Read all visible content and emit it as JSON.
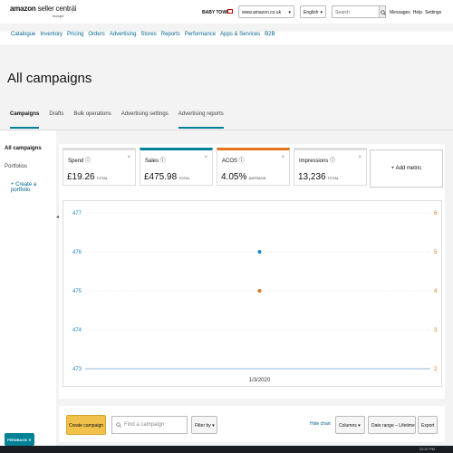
{
  "header": {
    "logo_main": "amazon",
    "logo_light": " seller central",
    "logo_region": "europe",
    "store_name": "BABY TOWN",
    "domain": "www.amazon.co.uk",
    "language": "English",
    "search_placeholder": "Search",
    "links": [
      "Messages",
      "Help",
      "Settings"
    ]
  },
  "nav": [
    "Catalogue",
    "Inventory",
    "Pricing",
    "Orders",
    "Advertising",
    "Stores",
    "Reports",
    "Performance",
    "Apps & Services",
    "B2B"
  ],
  "page_title": "All campaigns",
  "tabs": [
    "Campaigns",
    "Drafts",
    "Bulk operations",
    "Advertising settings",
    "Advertising reports"
  ],
  "sidebar": {
    "all_campaigns": "All campaigns",
    "portfolios": "Portfolios",
    "create_portfolio": "+ Create a portfolio"
  },
  "metrics": [
    {
      "label": "Spend",
      "value": "£19.26",
      "unit": "TOTAL",
      "color": "#dddddd"
    },
    {
      "label": "Sales",
      "value": "£475.98",
      "unit": "TOTAL",
      "color": "#008296"
    },
    {
      "label": "ACOS",
      "value": "4.05%",
      "unit": "AVERAGE",
      "color": "#e3741c"
    },
    {
      "label": "Impressions",
      "value": "13,236",
      "unit": "TOTAL",
      "color": "#dddddd"
    }
  ],
  "add_metric": "+ Add metric",
  "chart_data": {
    "type": "scatter",
    "x": [
      "1/3/2020"
    ],
    "left_axis": {
      "ticks": [
        "477",
        "476",
        "475",
        "474",
        "473"
      ],
      "color": "#1e88c9"
    },
    "right_axis": {
      "ticks": [
        "6",
        "5",
        "4",
        "3",
        "2"
      ],
      "color": "#e3741c"
    },
    "series": [
      {
        "values": [
          476
        ],
        "axis": "left",
        "color": "#1e88c9"
      },
      {
        "values": [
          4
        ],
        "axis": "right",
        "color": "#e3741c"
      }
    ],
    "ylim_left": [
      473,
      477
    ],
    "ylim_right": [
      2,
      6
    ]
  },
  "toolbar": {
    "create_campaign": "Create campaign",
    "find_placeholder": "Find a campaign",
    "filter_by": "Filter by",
    "hide_chart": "Hide chart",
    "columns": "Columns",
    "date_range": "Date range – Lifetime",
    "export": "Export"
  },
  "feedback": "FEEDBACK",
  "clock": "12:37 PM"
}
